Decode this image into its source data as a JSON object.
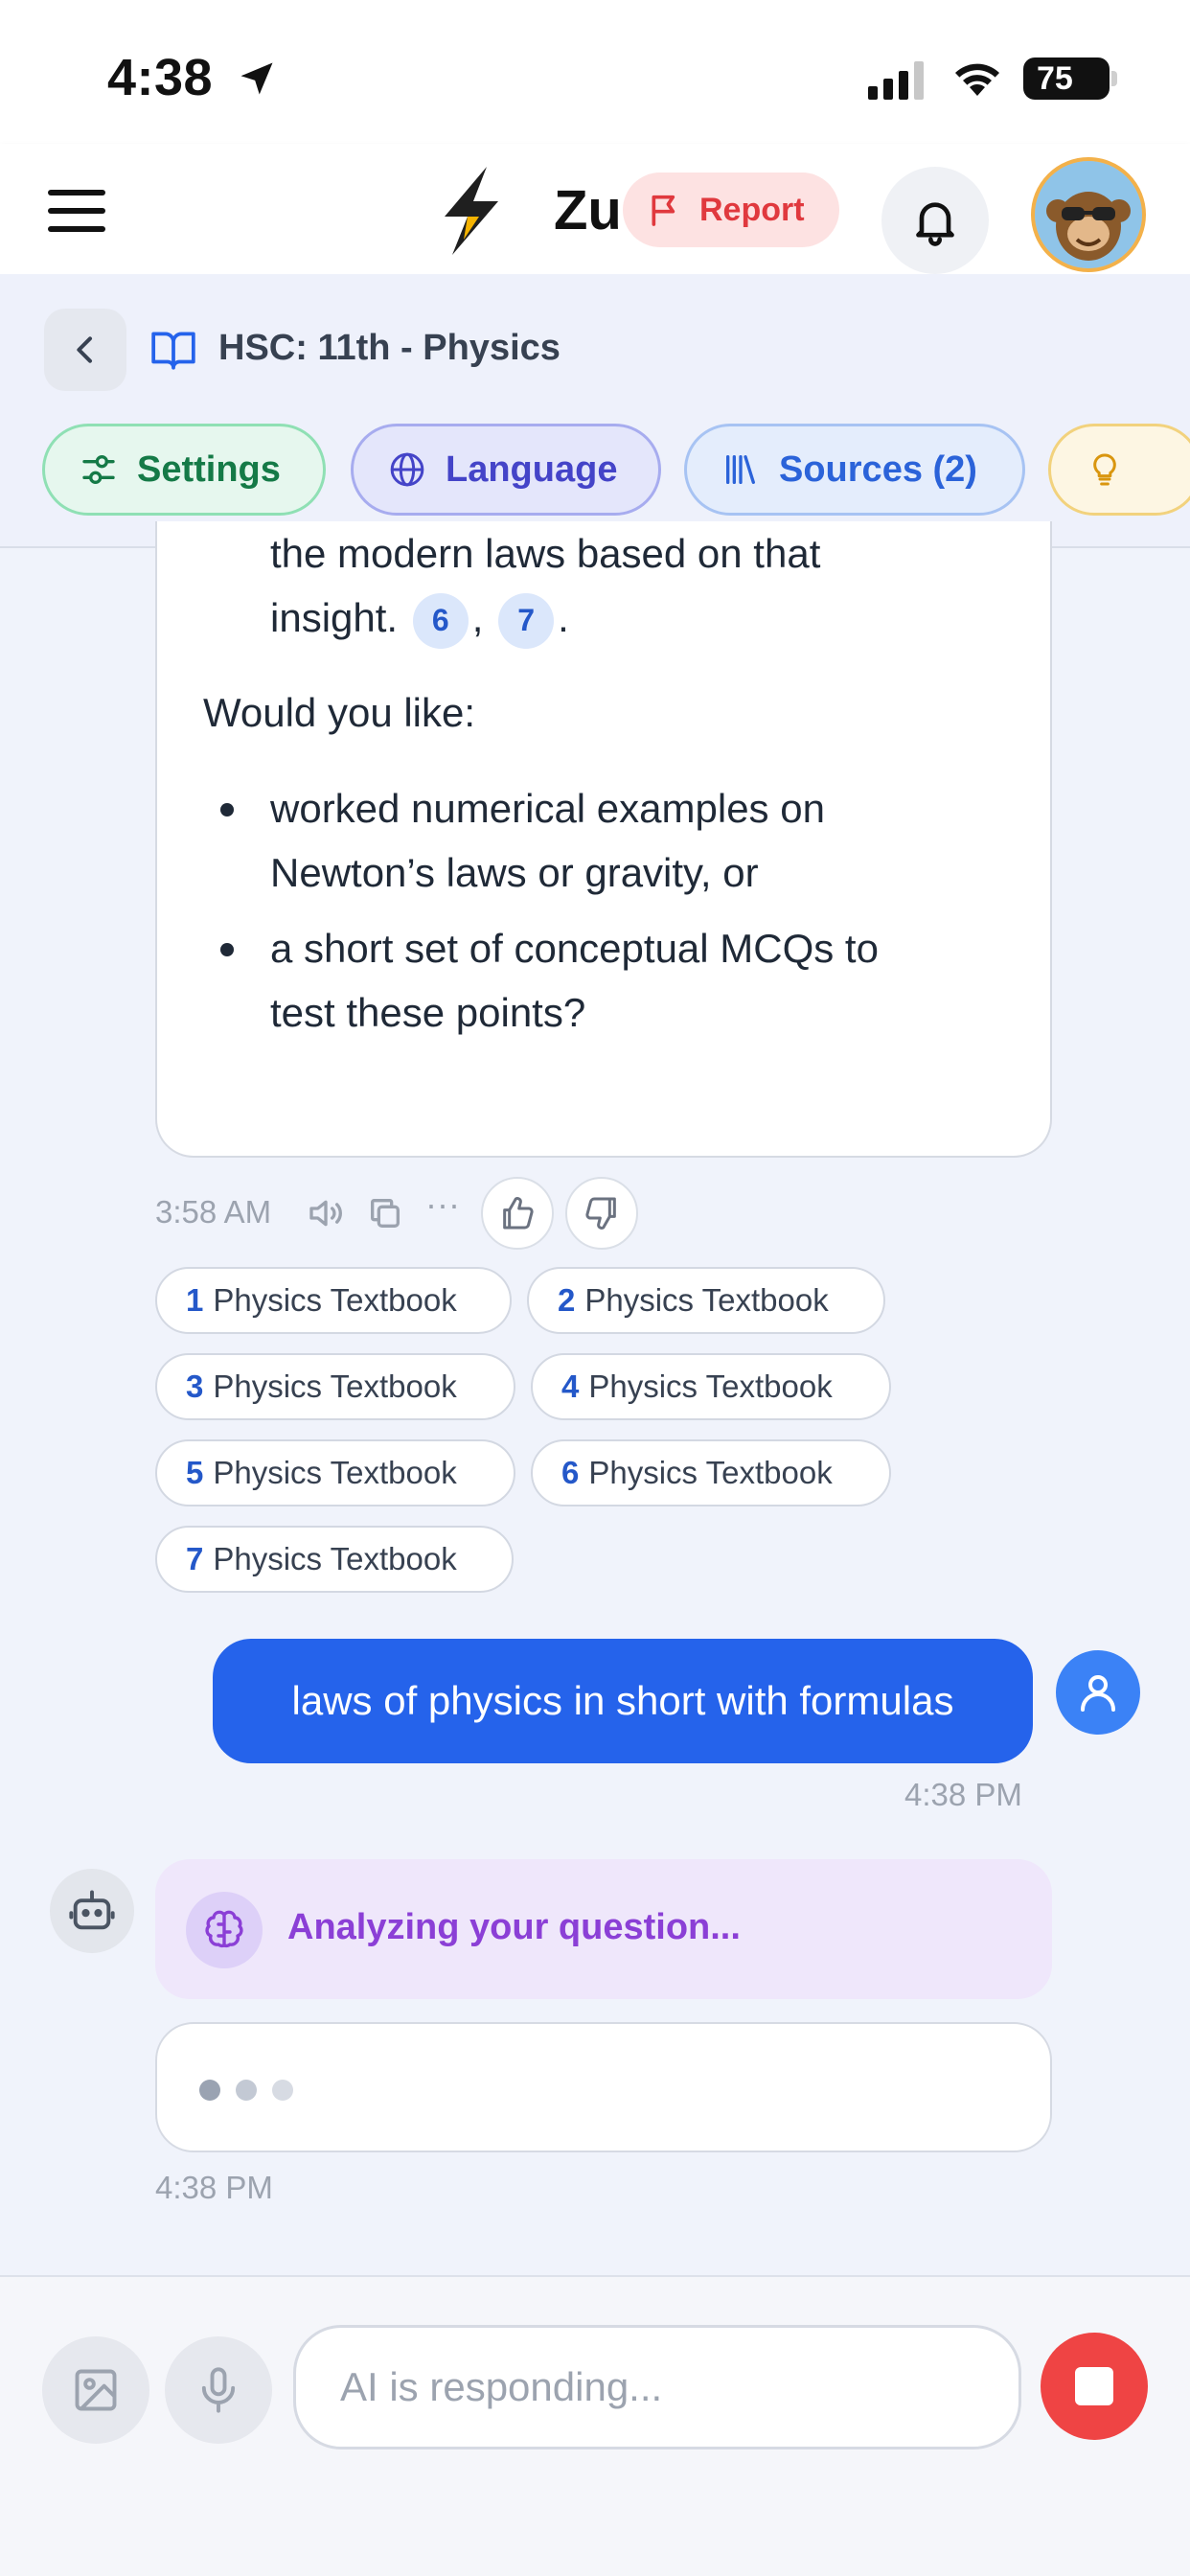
{
  "status_bar": {
    "time": "4:38",
    "battery": "75"
  },
  "header": {
    "brand": "Zu",
    "report_label": "Report"
  },
  "context": {
    "title": "HSC: 11th - Physics",
    "chips": {
      "settings": "Settings",
      "language": "Language",
      "sources": "Sources (2)"
    }
  },
  "ai_message": {
    "line1": "the modern laws based on that",
    "line2": "insight.",
    "cite_a": "6",
    "cite_b": "7",
    "sep": ",",
    "end": ".",
    "question": "Would you like:",
    "bullets": [
      {
        "l1": "worked numerical examples on",
        "l2": "Newton’s laws or gravity, or"
      },
      {
        "l1": "a short set of conceptual MCQs to",
        "l2": "test these points?"
      }
    ],
    "time": "3:58 AM",
    "more": "···"
  },
  "sources": [
    {
      "num": "1",
      "label": "Physics Textbook"
    },
    {
      "num": "2",
      "label": "Physics Textbook"
    },
    {
      "num": "3",
      "label": "Physics Textbook"
    },
    {
      "num": "4",
      "label": "Physics Textbook"
    },
    {
      "num": "5",
      "label": "Physics Textbook"
    },
    {
      "num": "6",
      "label": "Physics Textbook"
    },
    {
      "num": "7",
      "label": "Physics Textbook"
    }
  ],
  "user_message": {
    "text": "laws of physics in short with formulas",
    "time": "4:38 PM"
  },
  "analyzing": {
    "text": "Analyzing your question...",
    "time": "4:38 PM"
  },
  "composer": {
    "placeholder": "AI is responding..."
  },
  "colors": {
    "primary": "#2563eb",
    "stop": "#ef4444",
    "analyzing": "#8b3fd6"
  }
}
